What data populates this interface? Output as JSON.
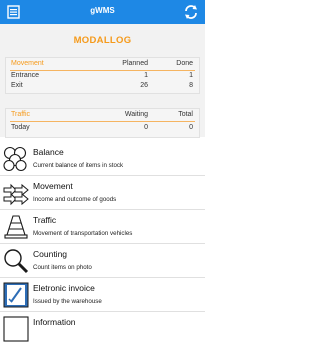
{
  "header": {
    "title": "gWMS",
    "menu_icon": "menu-icon",
    "refresh_icon": "refresh-icon",
    "color": "#1e88e5"
  },
  "brand": {
    "name": "MODALLOG",
    "color": "#f59a1b"
  },
  "movement_card": {
    "heading": "Movement",
    "col1": "Planned",
    "col2": "Done",
    "rows": [
      {
        "label": "Entrance",
        "planned": "1",
        "done": "1"
      },
      {
        "label": "Exit",
        "planned": "26",
        "done": "8"
      }
    ]
  },
  "traffic_card": {
    "heading": "Traffic",
    "col1": "Waiting",
    "col2": "Total",
    "rows": [
      {
        "label": "Today",
        "waiting": "0",
        "total": "0"
      }
    ]
  },
  "menu": [
    {
      "title": "Balance",
      "subtitle": "Current balance of items in stock",
      "icon": "balance-icon"
    },
    {
      "title": "Movement",
      "subtitle": "Income and outcome of goods",
      "icon": "movement-icon"
    },
    {
      "title": "Traffic",
      "subtitle": "Movement of transportation vehicles",
      "icon": "traffic-cone-icon"
    },
    {
      "title": "Counting",
      "subtitle": "Count items on photo",
      "icon": "magnifier-icon"
    },
    {
      "title": "Eletronic invoice",
      "subtitle": "Issued by the warehouse",
      "icon": "invoice-icon"
    },
    {
      "title": "Information",
      "subtitle": "",
      "icon": "info-icon"
    }
  ]
}
